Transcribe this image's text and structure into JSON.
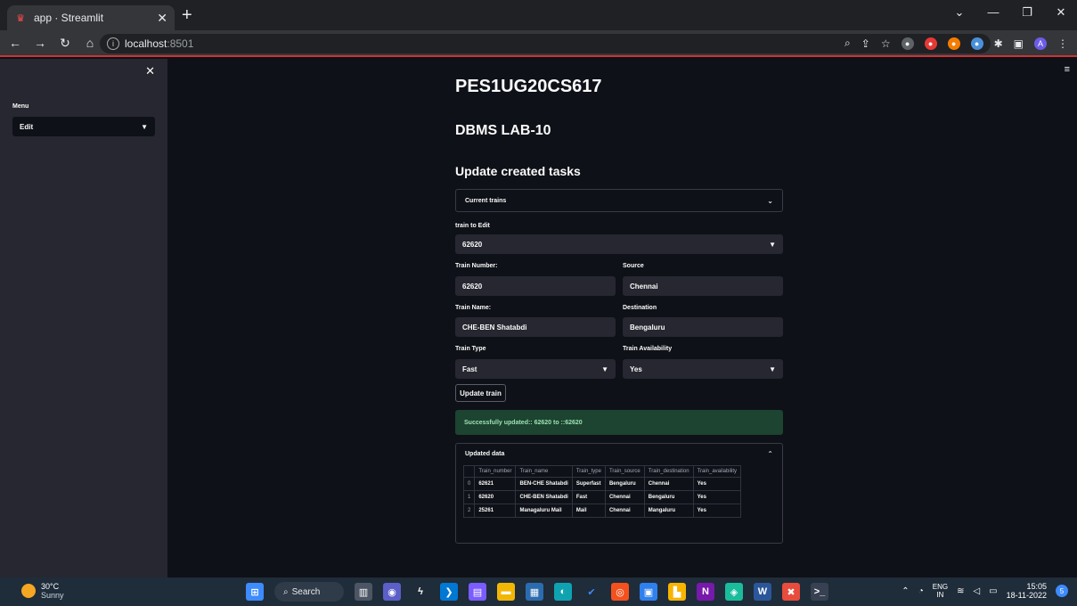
{
  "browser": {
    "tab_title": "app · Streamlit",
    "url_host": "localhost",
    "url_port": ":8501",
    "profile_initial": "A",
    "accent": "#ff4b4b"
  },
  "sidebar": {
    "menu_label": "Menu",
    "menu_value": "Edit"
  },
  "main": {
    "title": "PES1UG20CS617",
    "subtitle": "DBMS LAB-10",
    "section": "Update created tasks",
    "current_trains_label": "Current trains",
    "train_to_edit_label": "train to Edit",
    "train_to_edit_value": "62620",
    "fields": {
      "train_number_label": "Train Number:",
      "train_number_value": "62620",
      "source_label": "Source",
      "source_value": "Chennai",
      "train_name_label": "Train Name:",
      "train_name_value": "CHE-BEN Shatabdi",
      "destination_label": "Destination",
      "destination_value": "Bengaluru",
      "train_type_label": "Train Type",
      "train_type_value": "Fast",
      "availability_label": "Train Availability",
      "availability_value": "Yes"
    },
    "update_button": "Update train",
    "success_message": "Successfully updated:: 62620 to ::62620",
    "updated_data_label": "Updated data",
    "table": {
      "headers": [
        "",
        "Train_number",
        "Train_name",
        "Train_type",
        "Train_source",
        "Train_destination",
        "Train_availability"
      ],
      "rows": [
        [
          "0",
          "62621",
          "BEN-CHE Shatabdi",
          "Superfast",
          "Bengaluru",
          "Chennai",
          "Yes"
        ],
        [
          "1",
          "62620",
          "CHE-BEN Shatabdi",
          "Fast",
          "Chennai",
          "Bengaluru",
          "Yes"
        ],
        [
          "2",
          "25261",
          "Managaluru Mail",
          "Mail",
          "Chennai",
          "Mangaluru",
          "Yes"
        ]
      ]
    }
  },
  "taskbar": {
    "temperature": "30°C",
    "condition": "Sunny",
    "search_label": "Search",
    "lang_top": "ENG",
    "lang_bottom": "IN",
    "time": "15:05",
    "date": "18-11-2022",
    "notifications": "5"
  }
}
